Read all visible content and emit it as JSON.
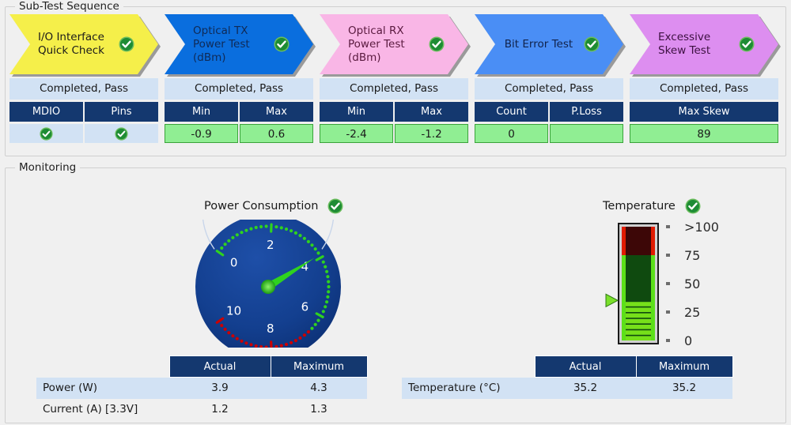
{
  "theme": {
    "page_bg": "#f0f0f0",
    "header_blue": "#14386f",
    "status_blue": "#d2e2f4",
    "pass_green": "#90ee93",
    "badge_green": "#1e8c34",
    "gauge_face": "#123c8c",
    "needle_green": "#2fd21f"
  },
  "subtest_group": {
    "title": "Sub-Test Sequence",
    "tests": [
      {
        "name": "I/O Interface\nQuick Check",
        "color": "#f5ef4a",
        "text_color": "#1a1a1a",
        "status": "Completed, Pass",
        "badge": "check-circle-icon",
        "columns": [
          {
            "header": "MDIO",
            "value": "",
            "style": "plain",
            "icon": "check-circle-icon"
          },
          {
            "header": "Pins",
            "value": "",
            "style": "plain",
            "icon": "check-circle-icon"
          }
        ]
      },
      {
        "name": "Optical TX\nPower Test\n(dBm)",
        "color": "#0a6ede",
        "text_color": "#102a56",
        "status": "Completed, Pass",
        "badge": "check-circle-icon",
        "columns": [
          {
            "header": "Min",
            "value": "-0.9",
            "style": "green",
            "icon": ""
          },
          {
            "header": "Max",
            "value": "0.6",
            "style": "green",
            "icon": ""
          }
        ]
      },
      {
        "name": "Optical RX\nPower Test\n(dBm)",
        "color": "#f9b6e6",
        "text_color": "#5a1a3f",
        "status": "Completed, Pass",
        "badge": "check-circle-icon",
        "columns": [
          {
            "header": "Min",
            "value": "-2.4",
            "style": "green",
            "icon": ""
          },
          {
            "header": "Max",
            "value": "-1.2",
            "style": "green",
            "icon": ""
          }
        ]
      },
      {
        "name": "Bit Error Test",
        "color": "#4a8ef5",
        "text_color": "#11224a",
        "status": "Completed, Pass",
        "badge": "check-circle-icon",
        "columns": [
          {
            "header": "Count",
            "value": "0",
            "style": "green",
            "icon": ""
          },
          {
            "header": "P.Loss",
            "value": "",
            "style": "green",
            "icon": ""
          }
        ]
      },
      {
        "name": "Excessive\nSkew Test",
        "color": "#dd8ef0",
        "text_color": "#3c1040",
        "status": "Completed, Pass",
        "badge": "check-circle-icon",
        "columns": [
          {
            "header": "Max Skew",
            "value": "89",
            "style": "green",
            "icon": ""
          }
        ]
      }
    ]
  },
  "monitoring_group": {
    "title": "Monitoring",
    "power": {
      "title": "Power Consumption",
      "badge": "check-circle-icon"
    },
    "temperature": {
      "title": "Temperature",
      "badge": "check-circle-icon"
    }
  },
  "chart_data": [
    {
      "type": "gauge",
      "title": "Power Consumption",
      "value": 3.9,
      "unit": "W",
      "min": 0,
      "max": 10,
      "tick_labels": [
        "0",
        "2",
        "4",
        "6",
        "8",
        "10"
      ],
      "tick_values": [
        0,
        2,
        4,
        6,
        8,
        10
      ],
      "zones": [
        {
          "from": 0,
          "to": 6.5,
          "color": "#2fd21f",
          "label": "normal"
        },
        {
          "from": 6.5,
          "to": 10,
          "color": "#cc0000",
          "label": "alert"
        }
      ],
      "needle_color": "#2fd21f",
      "face_color": "#123c8c"
    },
    {
      "type": "thermometer",
      "title": "Temperature",
      "value": 35.2,
      "unit": "°C",
      "min": 0,
      "max": 100,
      "tick_labels": [
        ">100",
        "75",
        "50",
        "25",
        "0"
      ],
      "tick_values": [
        100,
        75,
        50,
        25,
        0
      ],
      "zones": [
        {
          "from": 0,
          "to": 35.2,
          "color": "#76e01a",
          "label": "filled"
        },
        {
          "from": 35.2,
          "to": 75,
          "color": "#0f4a0f",
          "label": "ok-empty"
        },
        {
          "from": 75,
          "to": 100,
          "color": "#3d0707",
          "label": "alert-empty"
        }
      ],
      "pointer_value": 35.2,
      "pointer_color": "#7ae02a"
    }
  ],
  "power_table": {
    "headers": [
      "",
      "Actual",
      "Maximum"
    ],
    "rows": [
      {
        "label": "Power (W)",
        "actual": "3.9",
        "maximum": "4.3",
        "shaded": true
      },
      {
        "label": "Current (A) [3.3V]",
        "actual": "1.2",
        "maximum": "1.3",
        "shaded": false
      }
    ]
  },
  "temp_table": {
    "headers": [
      "",
      "Actual",
      "Maximum"
    ],
    "rows": [
      {
        "label": "Temperature (°C)",
        "actual": "35.2",
        "maximum": "35.2",
        "shaded": true
      }
    ]
  }
}
